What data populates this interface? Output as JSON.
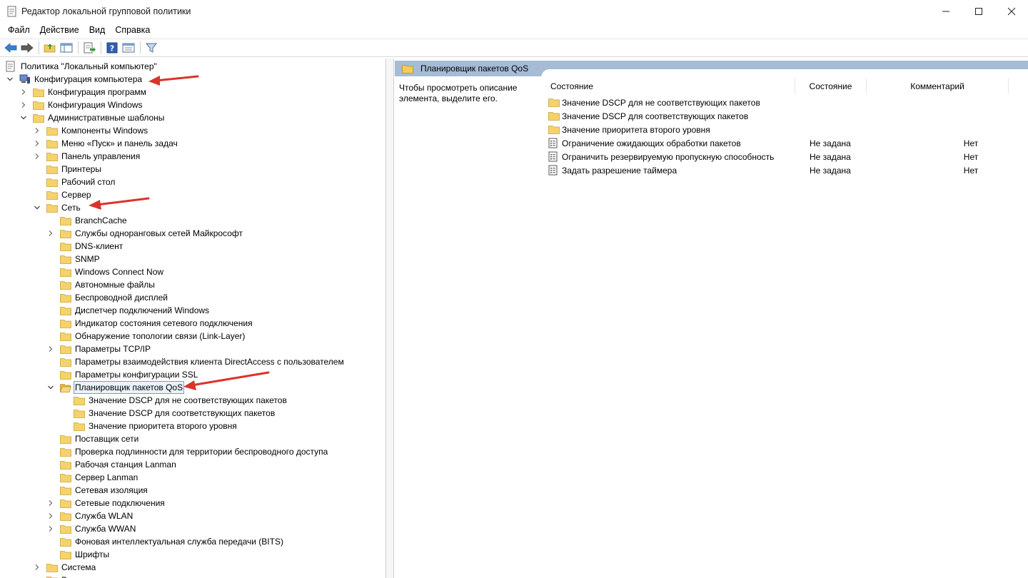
{
  "window": {
    "title": "Редактор локальной групповой политики",
    "controls": [
      "minimize-icon",
      "maximize-icon",
      "close-icon"
    ]
  },
  "menu": [
    "Файл",
    "Действие",
    "Вид",
    "Справка"
  ],
  "toolbar": [
    "back-arrow-icon",
    "forward-arrow-icon",
    "up-folder-icon",
    "show-hide-tree-icon",
    "export-list-icon",
    "help-icon",
    "properties-icon",
    "filter-icon"
  ],
  "tree": [
    {
      "label": "Политика \"Локальный компьютер\"",
      "level": 0,
      "expander": "none",
      "icon": "policy"
    },
    {
      "label": "Конфигурация компьютера",
      "level": 0,
      "expander": "expanded",
      "icon": "computer"
    },
    {
      "label": "Конфигурация программ",
      "level": 1,
      "expander": "collapsed",
      "icon": "folder"
    },
    {
      "label": "Конфигурация Windows",
      "level": 1,
      "expander": "collapsed",
      "icon": "folder"
    },
    {
      "label": "Административные шаблоны",
      "level": 1,
      "expander": "expanded",
      "icon": "folder"
    },
    {
      "label": "Компоненты Windows",
      "level": 2,
      "expander": "collapsed",
      "icon": "folder"
    },
    {
      "label": "Меню «Пуск» и панель задач",
      "level": 2,
      "expander": "collapsed",
      "icon": "folder"
    },
    {
      "label": "Панель управления",
      "level": 2,
      "expander": "collapsed",
      "icon": "folder"
    },
    {
      "label": "Принтеры",
      "level": 2,
      "expander": "none",
      "icon": "folder"
    },
    {
      "label": "Рабочий стол",
      "level": 2,
      "expander": "none",
      "icon": "folder"
    },
    {
      "label": "Сервер",
      "level": 2,
      "expander": "none",
      "icon": "folder"
    },
    {
      "label": "Сеть",
      "level": 2,
      "expander": "expanded",
      "icon": "folder"
    },
    {
      "label": "BranchCache",
      "level": 3,
      "expander": "none",
      "icon": "folder"
    },
    {
      "label": "Службы одноранговых сетей Майкрософт",
      "level": 3,
      "expander": "collapsed",
      "icon": "folder"
    },
    {
      "label": "DNS-клиент",
      "level": 3,
      "expander": "none",
      "icon": "folder"
    },
    {
      "label": "SNMP",
      "level": 3,
      "expander": "none",
      "icon": "folder"
    },
    {
      "label": "Windows Connect Now",
      "level": 3,
      "expander": "none",
      "icon": "folder"
    },
    {
      "label": "Автономные файлы",
      "level": 3,
      "expander": "none",
      "icon": "folder"
    },
    {
      "label": "Беспроводной дисплей",
      "level": 3,
      "expander": "none",
      "icon": "folder"
    },
    {
      "label": "Диспетчер подключений Windows",
      "level": 3,
      "expander": "none",
      "icon": "folder"
    },
    {
      "label": "Индикатор состояния сетевого подключения",
      "level": 3,
      "expander": "none",
      "icon": "folder"
    },
    {
      "label": "Обнаружение топологии связи (Link-Layer)",
      "level": 3,
      "expander": "none",
      "icon": "folder"
    },
    {
      "label": "Параметры TCP/IP",
      "level": 3,
      "expander": "collapsed",
      "icon": "folder"
    },
    {
      "label": "Параметры взаимодействия клиента DirectAccess с пользователем",
      "level": 3,
      "expander": "none",
      "icon": "folder"
    },
    {
      "label": "Параметры конфигурации SSL",
      "level": 3,
      "expander": "none",
      "icon": "folder"
    },
    {
      "label": "Планировщик пакетов QoS",
      "level": 3,
      "expander": "expanded",
      "icon": "folder-open",
      "selected": true
    },
    {
      "label": "Значение DSCP для не соответствующих пакетов",
      "level": 4,
      "expander": "none",
      "icon": "folder"
    },
    {
      "label": "Значение DSCP для соответствующих пакетов",
      "level": 4,
      "expander": "none",
      "icon": "folder"
    },
    {
      "label": "Значение приоритета второго уровня",
      "level": 4,
      "expander": "none",
      "icon": "folder"
    },
    {
      "label": "Поставщик сети",
      "level": 3,
      "expander": "none",
      "icon": "folder"
    },
    {
      "label": "Проверка подлинности для территории беспроводного доступа",
      "level": 3,
      "expander": "none",
      "icon": "folder"
    },
    {
      "label": "Рабочая станция Lanman",
      "level": 3,
      "expander": "none",
      "icon": "folder"
    },
    {
      "label": "Сервер Lanman",
      "level": 3,
      "expander": "none",
      "icon": "folder"
    },
    {
      "label": "Сетевая изоляция",
      "level": 3,
      "expander": "none",
      "icon": "folder"
    },
    {
      "label": "Сетевые подключения",
      "level": 3,
      "expander": "collapsed",
      "icon": "folder"
    },
    {
      "label": "Служба WLAN",
      "level": 3,
      "expander": "collapsed",
      "icon": "folder"
    },
    {
      "label": "Служба WWAN",
      "level": 3,
      "expander": "collapsed",
      "icon": "folder"
    },
    {
      "label": "Фоновая интеллектуальная служба передачи (BITS)",
      "level": 3,
      "expander": "none",
      "icon": "folder"
    },
    {
      "label": "Шрифты",
      "level": 3,
      "expander": "none",
      "icon": "folder"
    },
    {
      "label": "Система",
      "level": 2,
      "expander": "collapsed",
      "icon": "folder"
    },
    {
      "label": "Все параметры",
      "level": 2,
      "expander": "none",
      "icon": "folder"
    }
  ],
  "right": {
    "header": "Планировщик пакетов QoS",
    "description": "Чтобы просмотреть описание элемента, выделите его.",
    "columns": {
      "name": "Состояние",
      "state": "Состояние",
      "comment": "Комментарий"
    },
    "rows": [
      {
        "name": "Значение DSCP для не соответствующих пакетов",
        "state": "",
        "comment": "",
        "icon": "folder"
      },
      {
        "name": "Значение DSCP для соответствующих пакетов",
        "state": "",
        "comment": "",
        "icon": "folder"
      },
      {
        "name": "Значение приоритета второго уровня",
        "state": "",
        "comment": "",
        "icon": "folder"
      },
      {
        "name": "Ограничение ожидающих обработки пакетов",
        "state": "Не задана",
        "comment": "Нет",
        "icon": "setting"
      },
      {
        "name": "Ограничить резервируемую пропускную способность",
        "state": "Не задана",
        "comment": "Нет",
        "icon": "setting"
      },
      {
        "name": "Задать разрешение таймера",
        "state": "Не задана",
        "comment": "Нет",
        "icon": "setting"
      }
    ]
  },
  "colors": {
    "accent_header": "#a6bcd6",
    "folder": "#f2cb5a",
    "arrow": "#d9342b",
    "selection_border": "#7a9cc6"
  }
}
